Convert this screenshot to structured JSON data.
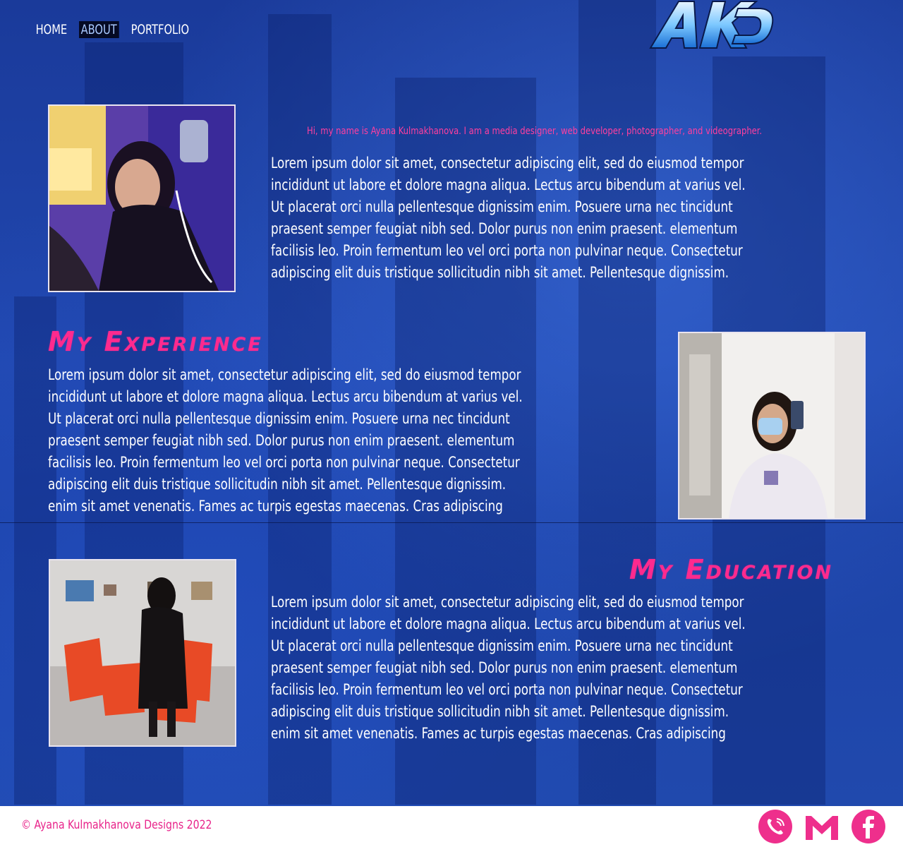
{
  "nav": {
    "home": "HOME",
    "about": "ABOUT",
    "portfolio": "PORTFOLIO"
  },
  "logo": {
    "text": "AKD"
  },
  "intro": {
    "tagline": "Hi, my name is Ayana Kulmakhanova. I am a media designer, web developer, photographer, and videographer.",
    "body": "Lorem ipsum dolor sit amet, consectetur adipiscing elit, sed do eiusmod tempor\nincididunt ut labore et dolore magna aliqua. Lectus arcu bibendum  at varius vel.\nUt placerat orci nulla pellentesque dignissim enim. Posuere urna    nec tincidunt\npraesent semper feugiat nibh sed. Dolor purus non enim praesent.   elementum\nfacilisis leo. Proin fermentum leo vel orci porta non pulvinar neque. Consectetur\nadipiscing elit duis tristique sollicitudin nibh sit amet. Pellentesque     dignissim."
  },
  "experience": {
    "heading": "My Experience",
    "body": "Lorem ipsum dolor sit amet, consectetur adipiscing elit, sed do eiusmod tempor\nincididunt ut labore et dolore magna aliqua. Lectus arcu bibendum  at varius vel.\nUt placerat orci nulla pellentesque dignissim enim. Posuere urna    nec tincidunt\npraesent semper feugiat nibh sed. Dolor purus non enim praesent.   elementum\nfacilisis leo. Proin fermentum leo vel orci porta non pulvinar neque. Consectetur\nadipiscing elit duis tristique sollicitudin nibh sit amet. Pellentesque     dignissim.\nenim sit amet venenatis. Fames ac turpis egestas maecenas. Cras      adipiscing"
  },
  "education": {
    "heading": "My Education",
    "body": "Lorem ipsum dolor sit amet, consectetur adipiscing elit, sed do eiusmod tempor\nincididunt ut labore et dolore magna aliqua. Lectus arcu bibendum  at varius vel.\nUt placerat orci nulla pellentesque dignissim enim. Posuere urna    nec tincidunt\npraesent semper feugiat nibh sed. Dolor purus non enim praesent.   elementum\nfacilisis leo. Proin fermentum leo vel orci porta non pulvinar neque. Consectetur\nadipiscing elit duis tristique sollicitudin nibh sit amet. Pellentesque     dignissim.\nenim sit amet venenatis. Fames ac turpis egestas maecenas. Cras      adipiscing"
  },
  "footer": {
    "copyright": "© Ayana Kulmakhanova Designs 2022",
    "icons": [
      "phone-icon",
      "gmail-icon",
      "facebook-icon"
    ]
  },
  "colors": {
    "accent": "#ff2a8e",
    "background": "#1d43a8",
    "footer_bg": "#ffffff",
    "nav_active_bg": "#050a24"
  }
}
